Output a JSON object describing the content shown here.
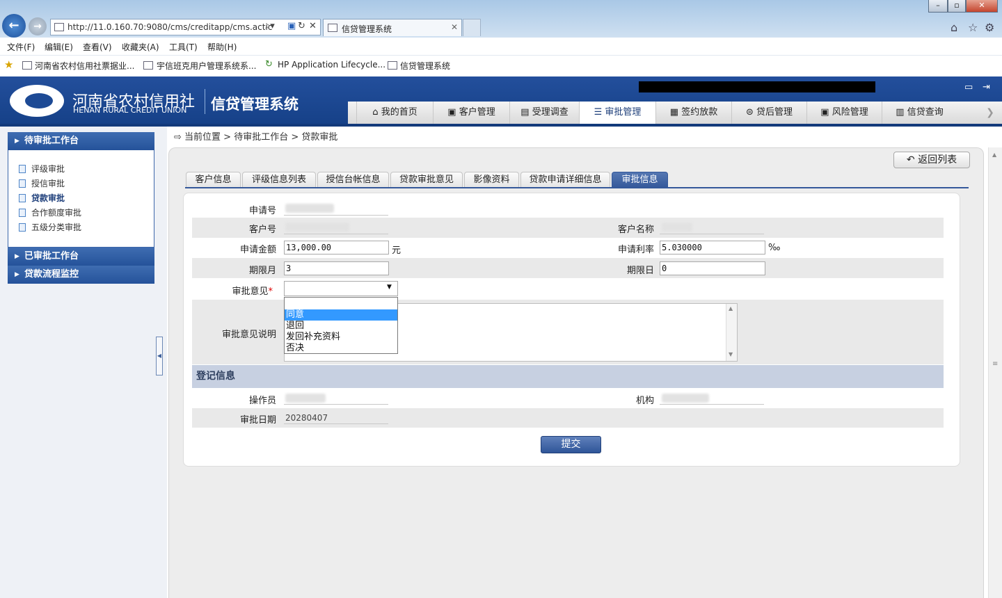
{
  "browser": {
    "url": "http://11.0.160.70:9080/cms/creditapp/cms.actic",
    "tab_title": "信贷管理系统",
    "menu": [
      "文件(F)",
      "编辑(E)",
      "查看(V)",
      "收藏夹(A)",
      "工具(T)",
      "帮助(H)"
    ],
    "favorites": [
      "河南省农村信用社票据业...",
      "宇信班克用户管理系统系...",
      "HP Application Lifecycle...",
      "信贷管理系统"
    ]
  },
  "app": {
    "logo_cn": "河南省农村信用社",
    "logo_en": "HENAN RURAL CREDIT UNION",
    "system_title": "信贷管理系统",
    "nav": [
      {
        "label": "我的首页",
        "icon": "home-icon"
      },
      {
        "label": "客户管理",
        "icon": "customer-icon"
      },
      {
        "label": "受理调查",
        "icon": "survey-icon"
      },
      {
        "label": "审批管理",
        "icon": "approval-icon"
      },
      {
        "label": "签约放款",
        "icon": "contract-icon"
      },
      {
        "label": "贷后管理",
        "icon": "postloan-icon"
      },
      {
        "label": "风险管理",
        "icon": "risk-icon"
      },
      {
        "label": "信贷查询",
        "icon": "query-icon"
      }
    ],
    "active_nav": "审批管理"
  },
  "sidebar": {
    "section1": "待审批工作台",
    "items": [
      "评级审批",
      "授信审批",
      "贷款审批",
      "合作额度审批",
      "五级分类审批"
    ],
    "active_item": "贷款审批",
    "section2": "已审批工作台",
    "section3": "贷款流程监控"
  },
  "breadcrumb": "当前位置 > 待审批工作台 > 贷款审批",
  "back_button": "返回列表",
  "content_tabs": [
    "客户信息",
    "评级信息列表",
    "授信台帐信息",
    "贷款审批意见",
    "影像资料",
    "贷款申请详细信息",
    "审批信息"
  ],
  "active_tab": "审批信息",
  "form": {
    "app_no_label": "申请号",
    "cust_no_label": "客户号",
    "cust_name_label": "客户名称",
    "amount_label": "申请金额",
    "amount_value": "13,000.00",
    "amount_unit": "元",
    "rate_label": "申请利率",
    "rate_value": "5.030000",
    "rate_unit": "‰",
    "term_month_label": "期限月",
    "term_month_value": "3",
    "term_day_label": "期限日",
    "term_day_value": "0",
    "opinion_label": "审批意见",
    "required_mark": "*",
    "opinion_options": [
      "同意",
      "退回",
      "发回补充资料",
      "否决"
    ],
    "opinion_highlighted": "同意",
    "opinion_desc_label": "审批意见说明"
  },
  "register": {
    "section_title": "登记信息",
    "operator_label": "操作员",
    "org_label": "机构",
    "date_label": "审批日期",
    "date_value": "20280407"
  },
  "submit_label": "提交",
  "colors": {
    "header": "#1d4a95",
    "accent": "#34589a",
    "highlight": "#3399ff"
  }
}
